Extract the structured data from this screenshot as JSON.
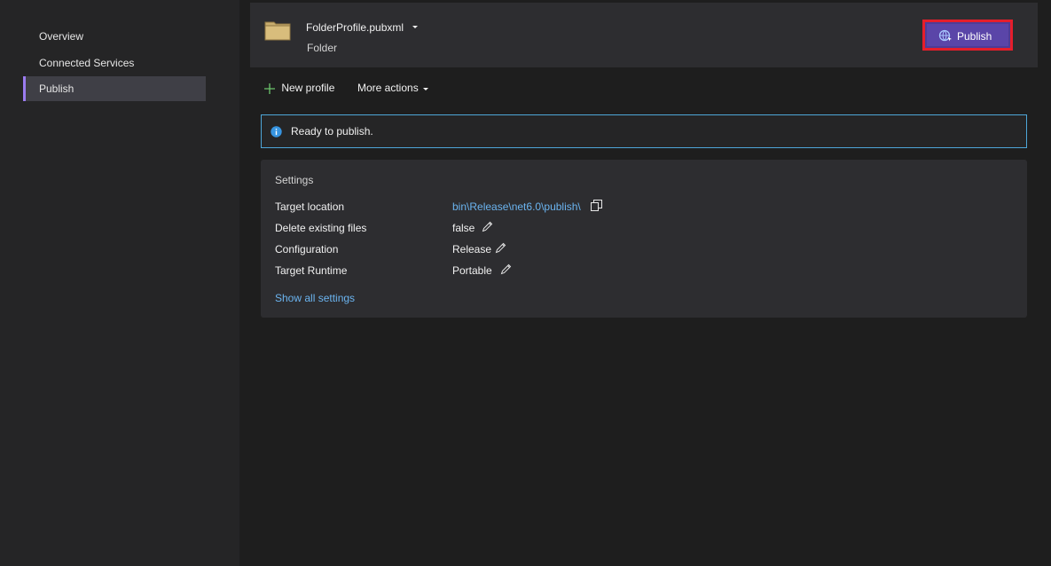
{
  "sidebar": {
    "items": [
      {
        "label": "Overview"
      },
      {
        "label": "Connected Services"
      },
      {
        "label": "Publish"
      }
    ]
  },
  "profile": {
    "name": "FolderProfile.pubxml",
    "type": "Folder",
    "publish_label": "Publish"
  },
  "actions": {
    "new_profile": "New profile",
    "more_actions": "More actions"
  },
  "info": {
    "message": "Ready to publish."
  },
  "settings": {
    "title": "Settings",
    "rows": [
      {
        "label": "Target location",
        "value": "bin\\Release\\net6.0\\publish\\"
      },
      {
        "label": "Delete existing files",
        "value": "false"
      },
      {
        "label": "Configuration",
        "value": "Release"
      },
      {
        "label": "Target Runtime",
        "value": "Portable"
      }
    ],
    "show_all": "Show all settings"
  },
  "colors": {
    "accent": "#9b7cf0",
    "publish_button": "#5a45a8",
    "highlight_border": "#e51e2b",
    "link": "#6bb4f0",
    "info_border": "#4ea6d8"
  },
  "icons": [
    "folder-icon",
    "chevron-down-icon",
    "globe-publish-icon",
    "plus-icon",
    "info-icon",
    "copy-icon",
    "pencil-icon"
  ]
}
